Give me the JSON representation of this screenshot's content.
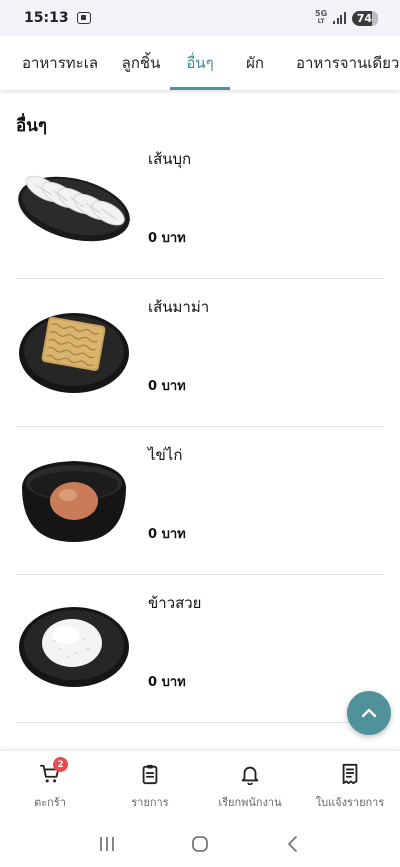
{
  "status_bar": {
    "time": "15:13",
    "network": "5G",
    "network_sub": "LT",
    "battery": "74"
  },
  "tabs": [
    {
      "label": "อาหารทะเล",
      "active": false
    },
    {
      "label": "ลูกชิ้น",
      "active": false
    },
    {
      "label": "อื่นๆ",
      "active": true
    },
    {
      "label": "ผัก",
      "active": false
    },
    {
      "label": "อาหารจานเดียว",
      "active": false
    }
  ],
  "section": {
    "title": "อื่นๆ"
  },
  "items": [
    {
      "name": "เส้นบุก",
      "price": "0 บาท",
      "image": "konjac-noodles-on-black-plate"
    },
    {
      "name": "เส้นมาม่า",
      "price": "0 บาท",
      "image": "instant-noodle-block-on-black-plate"
    },
    {
      "name": "ไข่ไก่",
      "price": "0 บาท",
      "image": "egg-in-black-bowl"
    },
    {
      "name": "ข้าวสวย",
      "price": "0 บาท",
      "image": "steamed-rice-on-black-plate"
    }
  ],
  "bottom_nav": [
    {
      "label": "ตะกร้า",
      "icon": "cart-icon",
      "badge": "2"
    },
    {
      "label": "รายการ",
      "icon": "clipboard-icon"
    },
    {
      "label": "เรียกพนักงาน",
      "icon": "bell-icon"
    },
    {
      "label": "ใบแจ้งรายการ",
      "icon": "receipt-icon"
    }
  ],
  "colors": {
    "accent": "#4f929a",
    "badge": "#e74c4c"
  }
}
